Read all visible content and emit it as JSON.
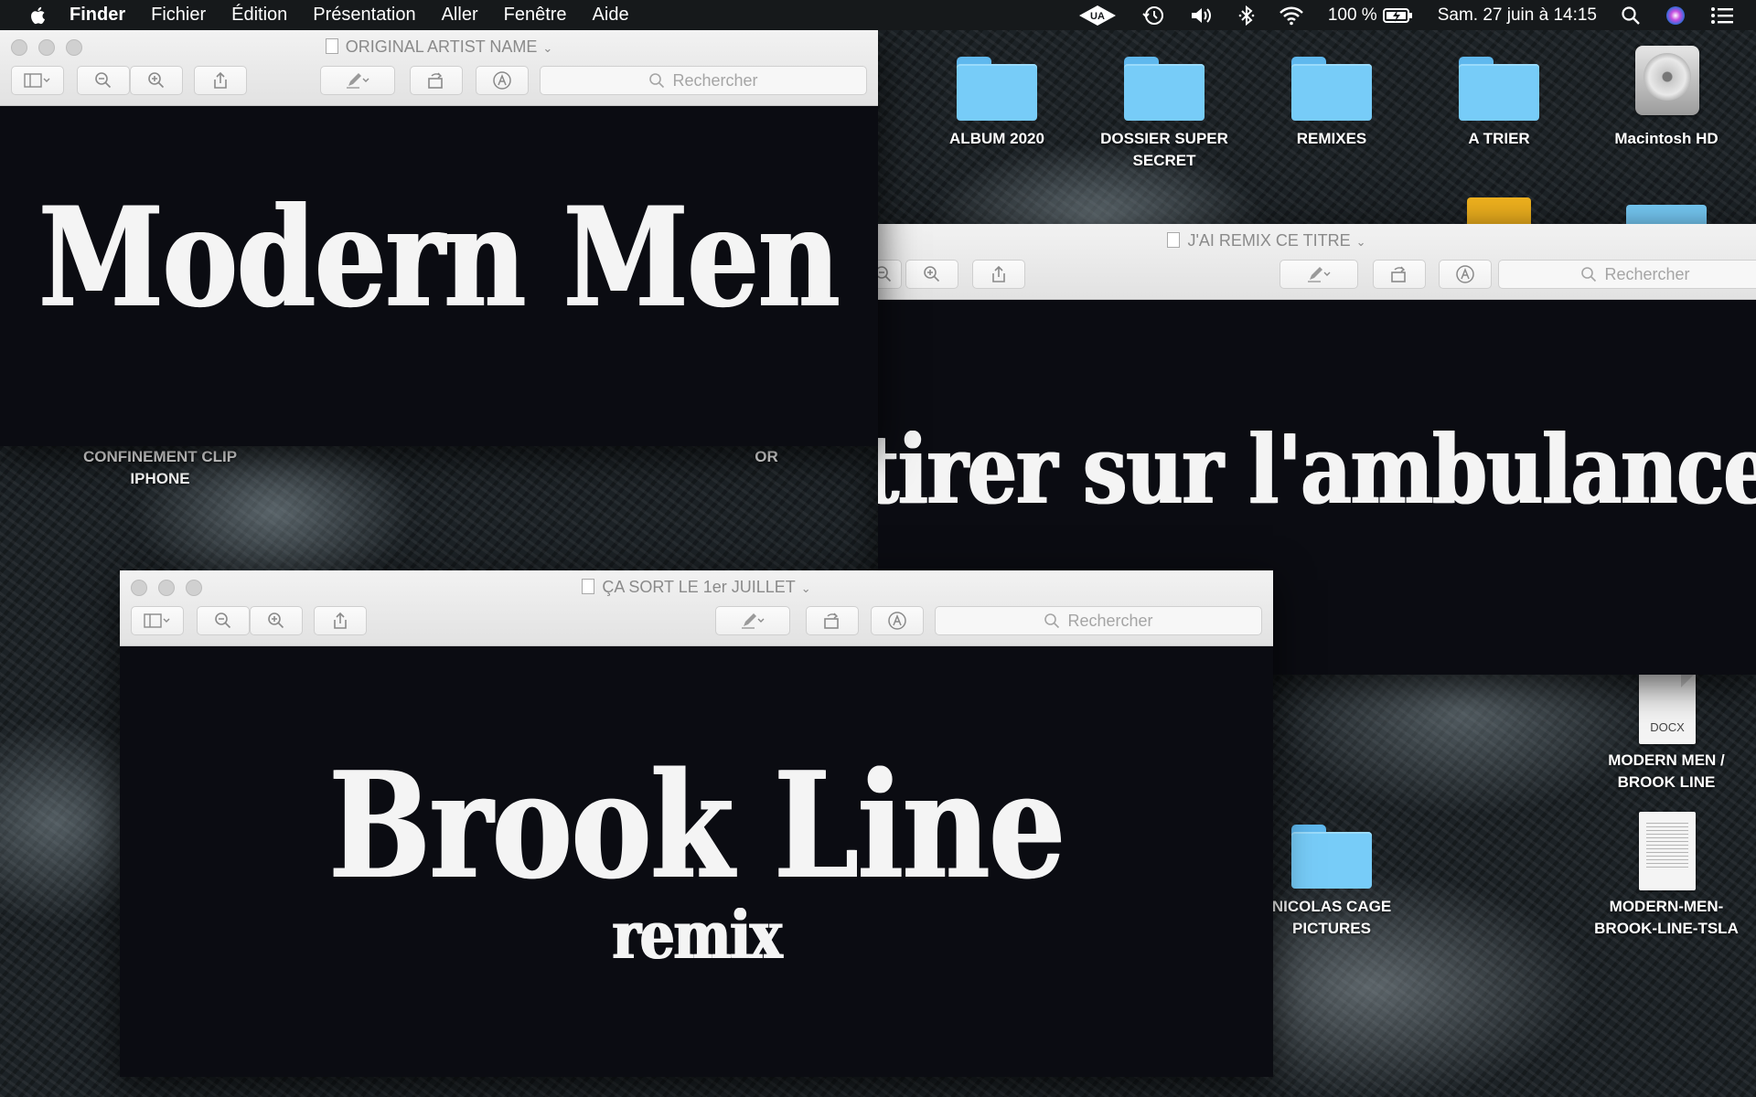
{
  "menubar": {
    "app_name": "Finder",
    "items": [
      "Fichier",
      "Édition",
      "Présentation",
      "Aller",
      "Fenêtre",
      "Aide"
    ],
    "battery": "100 %",
    "datetime": "Sam. 27 juin à 14:15",
    "status_icons": [
      "uad-icon",
      "time-machine-icon",
      "volume-icon",
      "bluetooth-icon",
      "wifi-icon",
      "battery-charging-icon",
      "search-icon",
      "siri-icon",
      "notification-center-icon"
    ]
  },
  "desktop": {
    "icons": [
      {
        "label": "ALBUM 2020",
        "type": "folder"
      },
      {
        "label": "DOSSIER SUPER SECRET",
        "type": "folder"
      },
      {
        "label": "REMIXES",
        "type": "folder"
      },
      {
        "label": "A TRIER",
        "type": "folder"
      },
      {
        "label": "Macintosh HD",
        "type": "disk"
      },
      {
        "label": "CONFINEMENT CLIP IPHONE",
        "type": "folder"
      },
      {
        "label": "OR",
        "type": "folder"
      },
      {
        "label": "MODERN MEN / BROOK LINE",
        "type": "docx",
        "ext": "DOCX"
      },
      {
        "label": "NICOLAS CAGE PICTURES",
        "type": "folder"
      },
      {
        "label": "MODERN-MEN-BROOK-LINE-TSLA",
        "type": "document"
      }
    ]
  },
  "windows": [
    {
      "title": "ORIGINAL ARTIST NAME",
      "search_placeholder": "Rechercher",
      "content": "Modern Men"
    },
    {
      "title": "J'AI REMIX CE TITRE",
      "search_placeholder": "Rechercher",
      "content": "tirer sur l'ambulance"
    },
    {
      "title": "ÇA SORT LE 1er JUILLET",
      "search_placeholder": "Rechercher",
      "content": "Brook Line",
      "subcontent": "remix"
    }
  ]
}
